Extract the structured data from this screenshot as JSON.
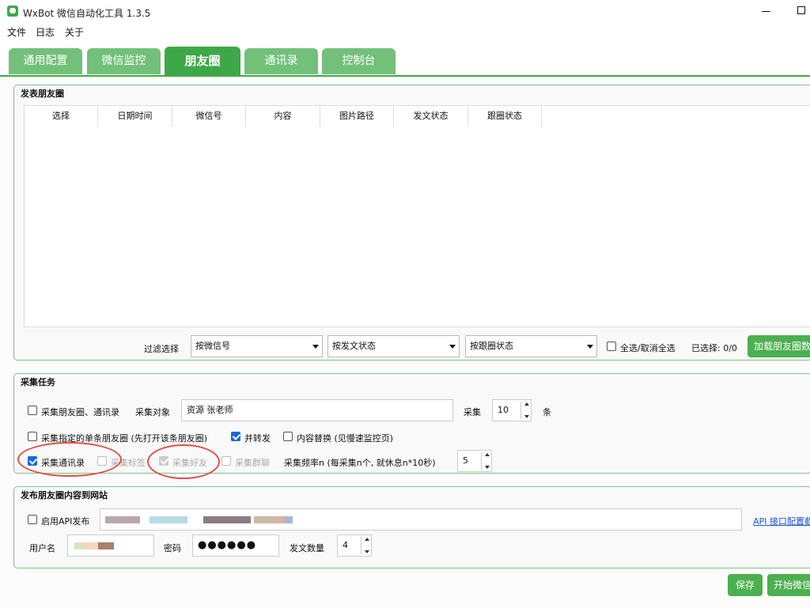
{
  "window": {
    "title": "WxBot 微信自动化工具 1.3.5"
  },
  "menu": [
    "文件",
    "日志",
    "关于"
  ],
  "tabs": [
    "通用配置",
    "微信监控",
    "朋友圈",
    "通讯录",
    "控制台"
  ],
  "publish": {
    "group_title": "发表朋友圈",
    "columns": [
      "选择",
      "日期时间",
      "微信号",
      "内容",
      "图片路径",
      "发文状态",
      "跟圈状态"
    ],
    "filter_label": "过滤选择",
    "filter_wechat": "按微信号",
    "filter_status": "按发文状态",
    "filter_follow": "按跟圈状态",
    "select_all_label": "全选/取消全选",
    "selected_count": "已选择: 0/0",
    "load_button": "加载朋友圈数"
  },
  "collect": {
    "group_title": "采集任务",
    "moments_contacts_label": "采集朋友圈、通讯录",
    "target_label": "采集对象",
    "target_value": "资源 张老师",
    "collect_label": "采集",
    "collect_count": "10",
    "collect_unit": "条",
    "single_moment_label": "采集指定的单条朋友圈 (先打开该条朋友圈)",
    "forward_label": "并转发",
    "replace_label": "内容替换 (见慢速监控页)",
    "contacts_label": "采集通讯录",
    "tags_label": "采集标签",
    "friends_label": "采集好友",
    "groups_label": "采集群聊",
    "frequency_label": "采集频率n (每采集n个, 就休息n*10秒)",
    "frequency_value": "5"
  },
  "website": {
    "group_title": "发布朋友圈内容到网站",
    "api_label": "启用API发布",
    "api_link": "API 接口配置截",
    "username_label": "用户名",
    "password_label": "密码",
    "password_value": "●●●●●●",
    "post_count_label": "发文数量",
    "post_count_value": "4"
  },
  "actions": {
    "save": "保存",
    "start": "开始微信"
  },
  "colors": {
    "tab_green": "#72c07a",
    "tab_active": "#3ea848",
    "button_green": "#4caf50",
    "highlight_red": "#e0504a",
    "checkbox_blue": "#1769d6"
  }
}
